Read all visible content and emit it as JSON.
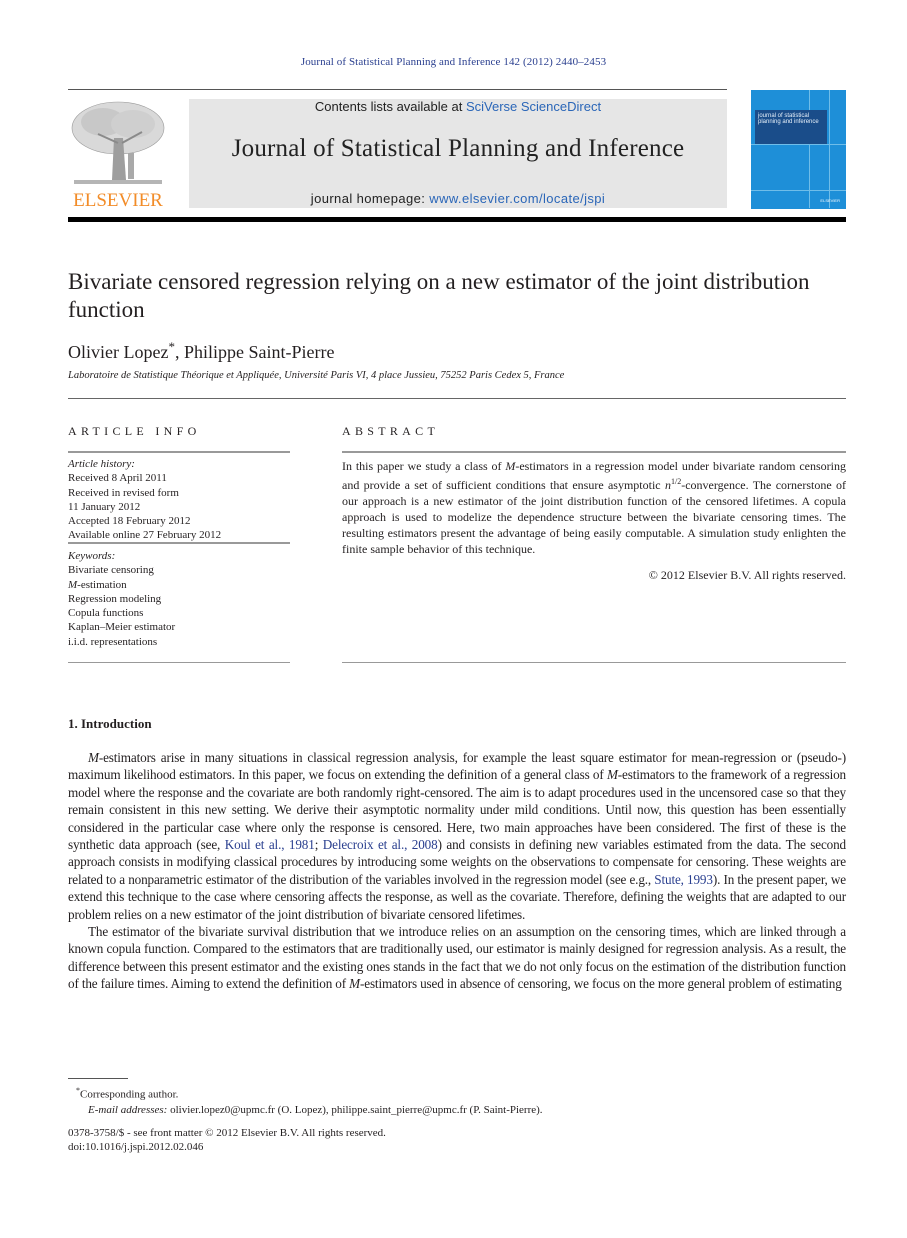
{
  "header": {
    "journal_reference": "Journal of Statistical Planning and Inference 142 (2012) 2440–2453",
    "publisher_wordmark": "ELSEVIER",
    "contents_prefix": "Contents lists available at ",
    "contents_link": "SciVerse ScienceDirect",
    "journal_title": "Journal of Statistical Planning and Inference",
    "homepage_prefix": "journal homepage: ",
    "homepage_link": "www.elsevier.com/locate/jspi",
    "cover_text": "journal of statistical planning and inference",
    "cover_publisher": "ELSEVIER",
    "brand_color": "#f28c28",
    "link_color": "#2a66b8",
    "cover_color": "#1e8fd8"
  },
  "article": {
    "title": "Bivariate censored regression relying on a new estimator of the joint distribution function",
    "authors": [
      {
        "name": "Olivier Lopez",
        "mark": "*"
      },
      {
        "name": "Philippe Saint-Pierre",
        "mark": ""
      }
    ],
    "author_separator": ", ",
    "affiliation": "Laboratoire de Statistique Théorique et Appliquée, Université Paris VI, 4 place Jussieu, 75252 Paris Cedex 5, France"
  },
  "article_info": {
    "heading": "ARTICLE INFO",
    "history_label": "Article history:",
    "history": [
      "Received 8 April 2011",
      "Received in revised form",
      "11 January 2012",
      "Accepted 18 February 2012",
      "Available online 27 February 2012"
    ],
    "keywords_label": "Keywords:",
    "keywords": [
      "Bivariate censoring",
      "M-estimation",
      "Regression modeling",
      "Copula functions",
      "Kaplan–Meier estimator",
      "i.i.d. representations"
    ]
  },
  "abstract": {
    "heading": "ABSTRACT",
    "text_1": "In this paper we study a class of ",
    "text_M": "M",
    "text_2": "-estimators in a regression model under bivariate random censoring and provide a set of sufficient conditions that ensure asymptotic ",
    "text_n": "n",
    "text_exp": "1/2",
    "text_3": "-convergence. The cornerstone of our approach is a new estimator of the joint distribution function of the censored lifetimes. A copula approach is used to modelize the dependence structure between the bivariate censoring times. The resulting estimators present the advantage of being easily computable. A simulation study enlighten the finite sample behavior of this technique.",
    "copyright": "© 2012 Elsevier B.V. All rights reserved."
  },
  "introduction": {
    "heading": "1.  Introduction",
    "p1": {
      "a_M": "M",
      "a": "-estimators arise in many situations in classical regression analysis, for example the least square estimator for mean-regression or (pseudo-) maximum likelihood estimators. In this paper, we focus on extending the definition of a general class of ",
      "b_M": "M",
      "b": "-estimators to the framework of a regression model where the response and the covariate are both randomly right-censored. The aim is to adapt procedures used in the uncensored case so that they remain consistent in this new setting. We derive their asymptotic normality under mild conditions. Until now, this question has been essentially considered in the particular case where only the response is censored. Here, two main approaches have been considered. The first of these is the synthetic data approach (see, ",
      "ref1": "Koul et al., 1981",
      "sep1": "; ",
      "ref2": "Delecroix et al., 2008",
      "c": ") and consists in defining new variables estimated from the data. The second approach consists in modifying classical procedures by introducing some weights on the observations to compensate for censoring. These weights are related to a nonparametric estimator of the distribution of the variables involved in the regression model (see e.g., ",
      "ref3": "Stute, 1993",
      "d": "). In the present paper, we extend this technique to the case where censoring affects the response, as well as the covariate. Therefore, defining the weights that are adapted to our problem relies on a new estimator of the joint distribution of bivariate censored lifetimes."
    },
    "p2": {
      "a": "The estimator of the bivariate survival distribution that we introduce relies on an assumption on the censoring times, which are linked through a known copula function. Compared to the estimators that are traditionally used, our estimator is mainly designed for regression analysis. As a result, the difference between this present estimator and the existing ones stands in the fact that we do not only focus on the estimation of the distribution function of the failure times. Aiming to extend the definition of ",
      "b_M": "M",
      "b": "-estimators used in absence of censoring, we focus on the more general problem of estimating"
    }
  },
  "footnotes": {
    "corresponding_mark": "*",
    "corresponding": "Corresponding author.",
    "email_label": "E-mail addresses:",
    "emails": " olivier.lopez0@upmc.fr (O. Lopez), philippe.saint_pierre@upmc.fr (P. Saint-Pierre)."
  },
  "issn": {
    "line1": "0378-3758/$ - see front matter © 2012 Elsevier B.V. All rights reserved.",
    "doi": "doi:10.1016/j.jspi.2012.02.046"
  }
}
